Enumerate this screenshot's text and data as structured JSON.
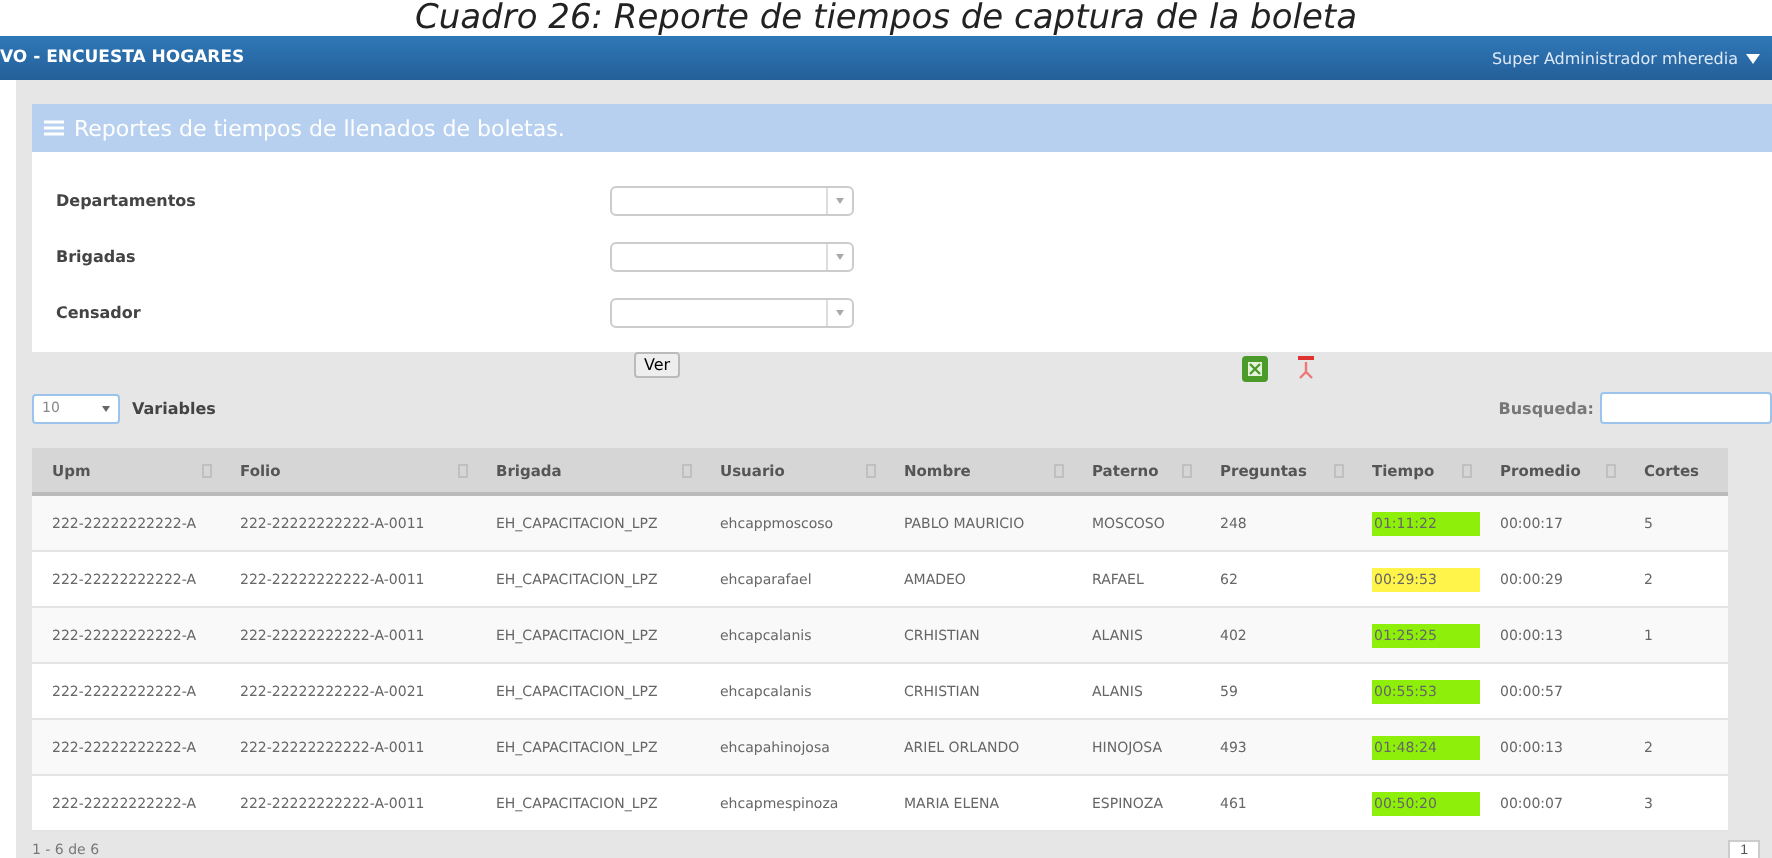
{
  "caption": "Cuadro 26: Reporte de tiempos de captura de la boleta",
  "navbar": {
    "title": "VO - ENCUESTA HOGARES",
    "user": "Super Administrador mheredia"
  },
  "panel": {
    "title": "Reportes de tiempos de llenados de boletas."
  },
  "filters": [
    {
      "label": "Departamentos"
    },
    {
      "label": "Brigadas"
    },
    {
      "label": "Censador"
    }
  ],
  "submit": "Ver",
  "page_size": {
    "value": "10",
    "label": "Variables"
  },
  "search": {
    "label": "Busqueda:"
  },
  "table": {
    "columns": [
      "Upm",
      "Folio",
      "Brigada",
      "Usuario",
      "Nombre",
      "Paterno",
      "Preguntas",
      "Tiempo",
      "Promedio",
      "Cortes"
    ],
    "rows": [
      {
        "cells": [
          "222-22222222222-A",
          "222-22222222222-A-0011",
          "EH_CAPACITACION_LPZ",
          "ehcappmoscoso",
          "PABLO MAURICIO",
          "MOSCOSO",
          "248",
          "01:11:22",
          "00:00:17",
          "5"
        ],
        "color": "#8ef00a"
      },
      {
        "cells": [
          "222-22222222222-A",
          "222-22222222222-A-0011",
          "EH_CAPACITACION_LPZ",
          "ehcaparafael",
          "AMADEO",
          "RAFAEL",
          "62",
          "00:29:53",
          "00:00:29",
          "2"
        ],
        "color": "#fff44a"
      },
      {
        "cells": [
          "222-22222222222-A",
          "222-22222222222-A-0011",
          "EH_CAPACITACION_LPZ",
          "ehcapcalanis",
          "CRHISTIAN",
          "ALANIS",
          "402",
          "01:25:25",
          "00:00:13",
          "1"
        ],
        "color": "#8ef00a"
      },
      {
        "cells": [
          "222-22222222222-A",
          "222-22222222222-A-0021",
          "EH_CAPACITACION_LPZ",
          "ehcapcalanis",
          "CRHISTIAN",
          "ALANIS",
          "59",
          "00:55:53",
          "00:00:57",
          ""
        ],
        "color": "#8ef00a"
      },
      {
        "cells": [
          "222-22222222222-A",
          "222-22222222222-A-0011",
          "EH_CAPACITACION_LPZ",
          "ehcapahinojosa",
          "ARIEL ORLANDO",
          "HINOJOSA",
          "493",
          "01:48:24",
          "00:00:13",
          "2"
        ],
        "color": "#8ef00a"
      },
      {
        "cells": [
          "222-22222222222-A",
          "222-22222222222-A-0011",
          "EH_CAPACITACION_LPZ",
          "ehcapmespinoza",
          "MARIA ELENA",
          "ESPINOZA",
          "461",
          "00:50:20",
          "00:00:07",
          "3"
        ],
        "color": "#8ef00a"
      }
    ]
  },
  "footer": {
    "info": "1 - 6 de 6",
    "page": "1"
  }
}
